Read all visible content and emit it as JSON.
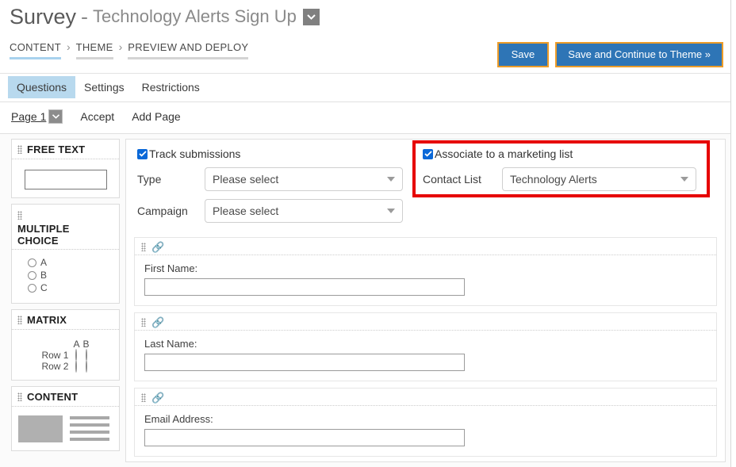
{
  "header": {
    "title_main": "Survey",
    "title_dash": "-",
    "title_sub": "Technology Alerts Sign Up",
    "caret_icon": "chevron-down-icon"
  },
  "breadcrumb": {
    "separator": "›",
    "items": [
      {
        "label": "CONTENT",
        "state": "active"
      },
      {
        "label": "THEME",
        "state": "inactive"
      },
      {
        "label": "PREVIEW AND DEPLOY",
        "state": "inactive"
      }
    ]
  },
  "actions": {
    "save_label": "Save",
    "save_continue_label": "Save and Continue to Theme »",
    "button_bg": "#2e75b6",
    "button_border": "#ed9c28"
  },
  "tabs": {
    "items": [
      {
        "label": "Questions",
        "selected": true
      },
      {
        "label": "Settings",
        "selected": false
      },
      {
        "label": "Restrictions",
        "selected": false
      }
    ],
    "selected_bg": "#b8d9ee"
  },
  "pagebar": {
    "page_label": "Page 1",
    "page_caret_icon": "chevron-down-icon",
    "accept_label": "Accept",
    "add_page_label": "Add Page"
  },
  "sidebar": {
    "items": [
      {
        "name": "free-text",
        "title": "FREE TEXT"
      },
      {
        "name": "multiple-choice",
        "title": "MULTIPLE CHOICE",
        "options": [
          "A",
          "B",
          "C"
        ]
      },
      {
        "name": "matrix",
        "title": "MATRIX",
        "columns": [
          "A",
          "B"
        ],
        "rows": [
          "Row 1",
          "Row 2"
        ]
      },
      {
        "name": "content",
        "title": "CONTENT"
      }
    ]
  },
  "tracking": {
    "track_submissions_label": "Track submissions",
    "track_submissions_checked": true,
    "type_label": "Type",
    "type_value": "Please select",
    "campaign_label": "Campaign",
    "campaign_value": "Please select"
  },
  "marketing": {
    "associate_label": "Associate to a marketing list",
    "associate_checked": true,
    "contact_list_label": "Contact List",
    "contact_list_value": "Technology Alerts",
    "highlight_color": "#e60000"
  },
  "questions": [
    {
      "label": "First Name:",
      "value": "",
      "link_icon": "link-icon",
      "grip_icon": "drag-handle-icon"
    },
    {
      "label": "Last Name:",
      "value": "",
      "link_icon": "link-icon",
      "grip_icon": "drag-handle-icon"
    },
    {
      "label": "Email Address:",
      "value": "",
      "link_icon": "link-icon",
      "grip_icon": "drag-handle-icon"
    }
  ]
}
